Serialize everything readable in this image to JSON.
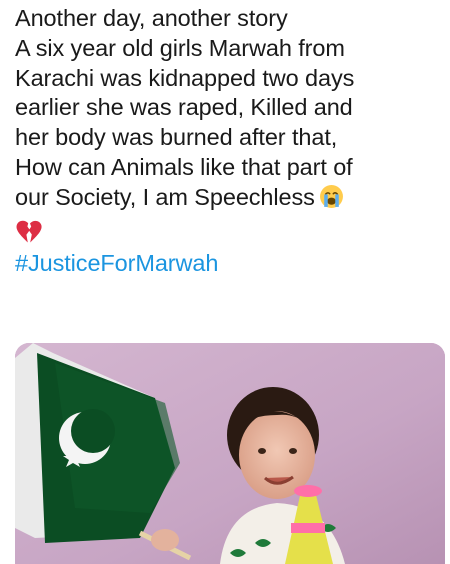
{
  "tweet": {
    "lines": [
      "Another day, another story",
      "A six year old girls Marwah from",
      "Karachi was kidnapped two days",
      "earlier she was raped, Killed and",
      "her body was burned after that,",
      "How can Animals like that part of",
      "our Society, I am Speechless"
    ],
    "emoji_after_text": "crying-face-emoji",
    "emoji_line": "broken-heart-emoji",
    "hashtag": "#JusticeForMarwah"
  },
  "media": {
    "description_icon": "photo-of-girl-with-pakistan-flag"
  },
  "colors": {
    "text": "#1a1a1a",
    "hashtag": "#1b95e0",
    "flag_green": "#01411c",
    "background_wall": "#c9a9c7"
  }
}
